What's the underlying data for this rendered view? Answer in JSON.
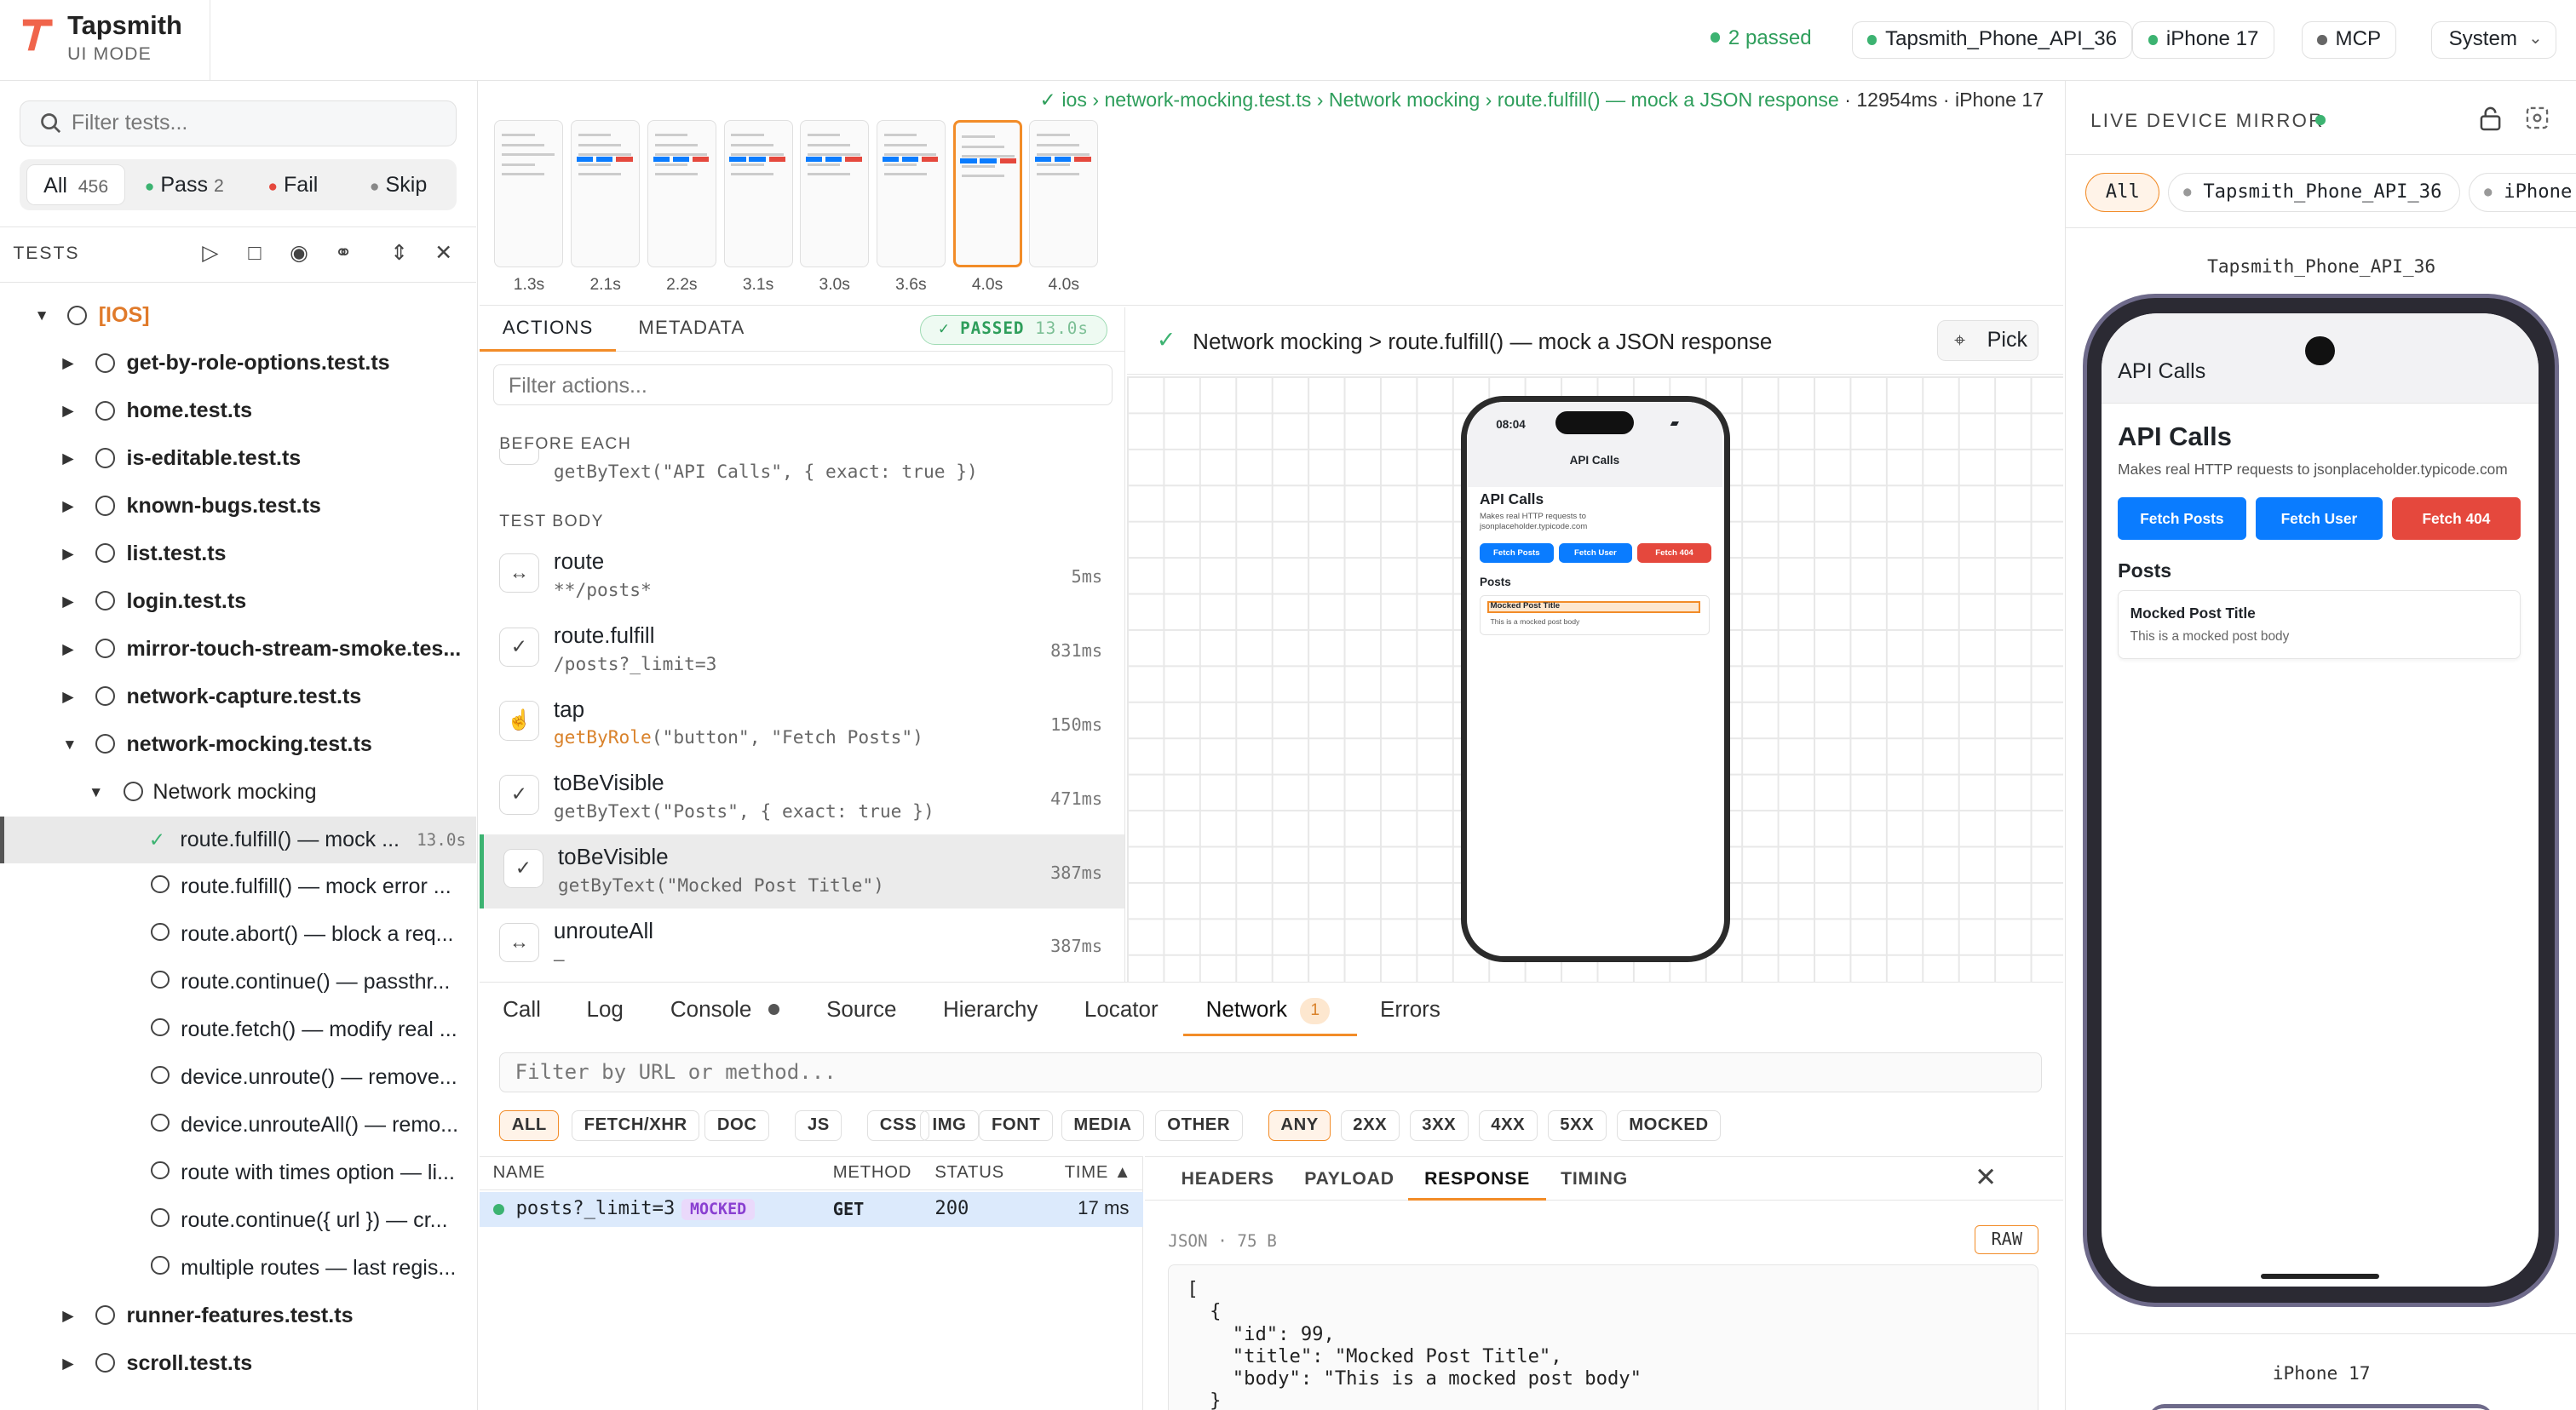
{
  "header": {
    "brand": "Tapsmith",
    "subtitle": "UI MODE",
    "passed": "2 passed",
    "device1": "Tapsmith_Phone_API_36",
    "device2": "iPhone 17",
    "mcp": "MCP",
    "theme": "System"
  },
  "sidebar": {
    "search_placeholder": "Filter tests...",
    "filters": {
      "all": "All",
      "all_count": "456",
      "pass": "Pass",
      "pass_count": "2",
      "fail": "Fail",
      "skip": "Skip"
    },
    "tests_label": "TESTS",
    "group": "[IOS]",
    "files": [
      "get-by-role-options.test.ts",
      "home.test.ts",
      "is-editable.test.ts",
      "known-bugs.test.ts",
      "list.test.ts",
      "login.test.ts",
      "mirror-touch-stream-smoke.tes...",
      "network-capture.test.ts",
      "network-mocking.test.ts"
    ],
    "suite": "Network mocking",
    "selected_test": "route.fulfill() — mock ...",
    "selected_time": "13.0s",
    "tests": [
      "route.fulfill() — mock error ...",
      "route.abort() — block a req...",
      "route.continue() — passthr...",
      "route.fetch() — modify real ...",
      "device.unroute() — remove...",
      "device.unrouteAll() — remo...",
      "route with times option — li...",
      "route.continue({ url }) — cr...",
      "multiple routes — last regis..."
    ],
    "after_files": [
      "runner-features.test.ts",
      "scroll.test.ts"
    ]
  },
  "trace": {
    "breadcrumb": "✓ ios › network-mocking.test.ts › Network mocking › route.fulfill() — mock a JSON response",
    "meta": "· 12954ms · iPhone 17",
    "thumbs": [
      "1.3s",
      "2.1s",
      "2.2s",
      "3.1s",
      "3.0s",
      "3.6s",
      "4.0s",
      "4.0s"
    ]
  },
  "actions": {
    "tab_actions": "ACTIONS",
    "tab_metadata": "METADATA",
    "badge": "PASSED",
    "badge_time": "13.0s",
    "filter_placeholder": "Filter actions...",
    "before_each": "BEFORE EACH",
    "before_each_sub": "getByText(\"API Calls\", { exact: true })",
    "test_body": "TEST BODY",
    "items": [
      {
        "name": "route",
        "sub": "**/posts*",
        "time": "5ms",
        "icon": "↔"
      },
      {
        "name": "route.fulfill",
        "sub": "/posts?_limit=3",
        "time": "831ms",
        "icon": "✓"
      },
      {
        "name": "tap",
        "sub_fn": "getByRole",
        "sub_args": "(\"button\", \"Fetch Posts\")",
        "time": "150ms",
        "icon": "☝"
      },
      {
        "name": "toBeVisible",
        "sub": "getByText(\"Posts\", { exact: true })",
        "time": "471ms",
        "icon": "✓"
      },
      {
        "name": "toBeVisible",
        "sub": "getByText(\"Mocked Post Title\")",
        "time": "387ms",
        "icon": "✓"
      },
      {
        "name": "unrouteAll",
        "sub": "—",
        "time": "387ms",
        "icon": "↔"
      }
    ]
  },
  "snapshot": {
    "title": "Network mocking > route.fulfill() — mock a JSON response",
    "pick": "Pick",
    "phone": {
      "time": "08:04",
      "nav_title": "API Calls",
      "heading": "API Calls",
      "desc": "Makes real HTTP requests to jsonplaceholder.typicode.com",
      "btn1": "Fetch Posts",
      "btn2": "Fetch User",
      "btn3": "Fetch 404",
      "posts": "Posts",
      "post_title": "Mocked Post Title",
      "post_body": "This is a mocked post body"
    }
  },
  "bottom": {
    "tabs": [
      "Call",
      "Log",
      "Console",
      "Source",
      "Hierarchy",
      "Locator",
      "Network",
      "Errors"
    ],
    "network_count": "1",
    "filter_placeholder": "Filter by URL or method...",
    "type_chips": [
      "ALL",
      "FETCH/XHR",
      "DOC",
      "JS",
      "CSS",
      "IMG",
      "FONT",
      "MEDIA",
      "OTHER"
    ],
    "status_chips": [
      "ANY",
      "2XX",
      "3XX",
      "4XX",
      "5XX",
      "MOCKED"
    ],
    "columns": {
      "name": "NAME",
      "method": "METHOD",
      "status": "STATUS",
      "time": "TIME ▲"
    },
    "row": {
      "name": "posts?_limit=3",
      "badge": "MOCKED",
      "method": "GET",
      "status": "200",
      "time": "17 ms"
    },
    "detail_tabs": [
      "HEADERS",
      "PAYLOAD",
      "RESPONSE",
      "TIMING"
    ],
    "json_meta": "JSON · 75 B",
    "raw": "RAW",
    "json_lines": [
      "[",
      "  {",
      "    \"id\": 99,",
      "    \"title\": \"Mocked Post Title\",",
      "    \"body\": \"This is a mocked post body\"",
      "  }"
    ]
  },
  "mirror": {
    "title": "LIVE DEVICE MIRROR",
    "chips": [
      "All",
      "Tapsmith_Phone_API_36",
      "iPhone"
    ],
    "device_label": "Tapsmith_Phone_API_36",
    "nav_title": "API Calls",
    "heading": "API Calls",
    "desc": "Makes real HTTP requests to jsonplaceholder.typicode.com",
    "btn1": "Fetch Posts",
    "btn2": "Fetch User",
    "btn3": "Fetch 404",
    "posts": "Posts",
    "post_title": "Mocked Post Title",
    "post_body": "This is a mocked post body",
    "device2_label": "iPhone 17"
  },
  "colors": {
    "accent": "#f28c28",
    "pass": "#3cb371",
    "fail": "#e5483d",
    "blue": "#0a7cff"
  }
}
